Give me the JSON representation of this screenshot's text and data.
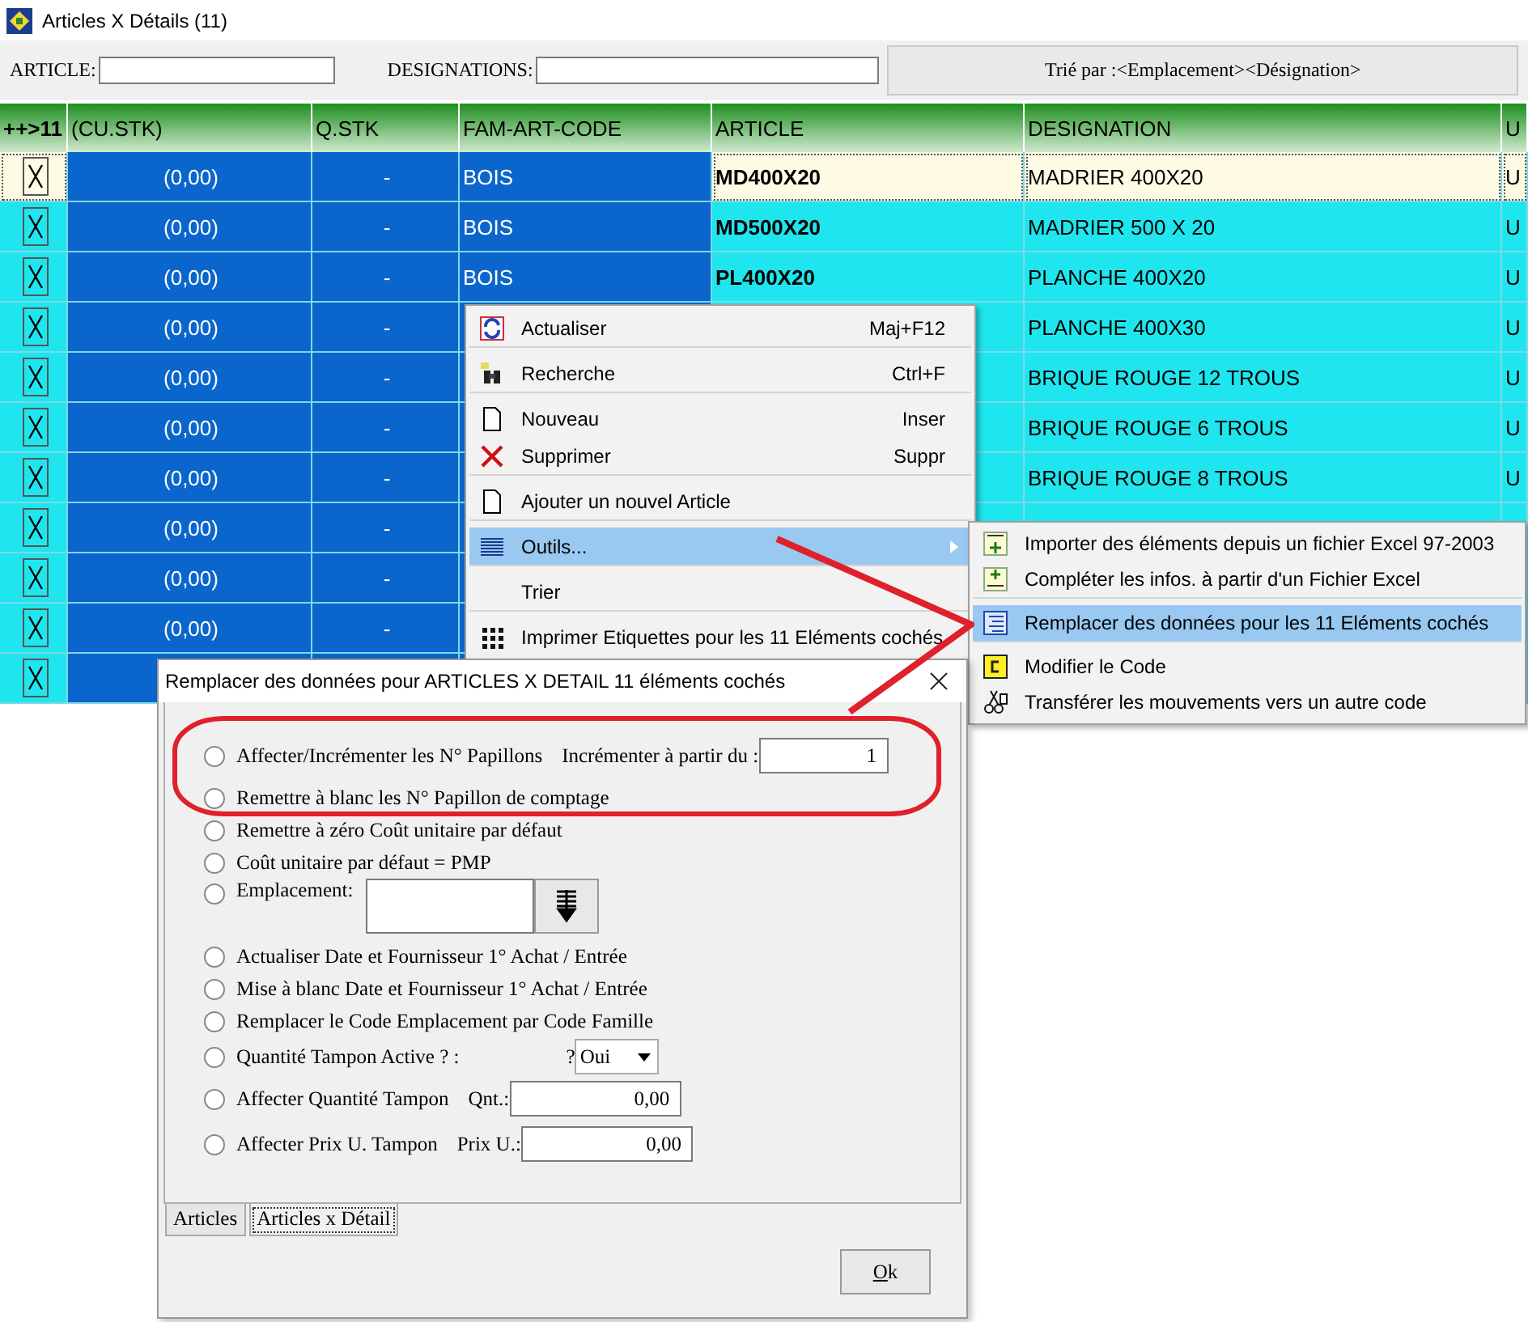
{
  "window": {
    "title": "Articles X Détails (11)"
  },
  "toolbar": {
    "article_label": "ARTICLE:",
    "designations_label": "DESIGNATIONS:",
    "sort_button": "Trié par :<Emplacement><Désignation>"
  },
  "table": {
    "columns": [
      "++>11",
      "(CU.STK)",
      "Q.STK",
      "FAM-ART-CODE",
      "ARTICLE",
      "DESIGNATION",
      "U"
    ],
    "rows": [
      {
        "selected": true,
        "checked": true,
        "cu_stk": "(0,00)",
        "q_stk": "-",
        "family": "BOIS",
        "article": "MD400X20",
        "designation": "MADRIER 400X20",
        "unit": "U"
      },
      {
        "selected": false,
        "checked": true,
        "cu_stk": "(0,00)",
        "q_stk": "-",
        "family": "BOIS",
        "article": "MD500X20",
        "designation": "MADRIER 500 X 20",
        "unit": "U"
      },
      {
        "selected": false,
        "checked": true,
        "cu_stk": "(0,00)",
        "q_stk": "-",
        "family": "BOIS",
        "article": "PL400X20",
        "designation": "PLANCHE 400X20",
        "unit": "U"
      },
      {
        "selected": false,
        "checked": true,
        "cu_stk": "(0,00)",
        "q_stk": "-",
        "designation": "PLANCHE 400X30",
        "unit": "U"
      },
      {
        "selected": false,
        "checked": true,
        "cu_stk": "(0,00)",
        "q_stk": "-",
        "designation": "BRIQUE ROUGE 12 TROUS",
        "unit": "U"
      },
      {
        "selected": false,
        "checked": true,
        "cu_stk": "(0,00)",
        "q_stk": "-",
        "designation": "BRIQUE ROUGE 6 TROUS",
        "unit": "U"
      },
      {
        "selected": false,
        "checked": true,
        "cu_stk": "(0,00)",
        "q_stk": "-",
        "designation": "BRIQUE ROUGE 8 TROUS",
        "unit": "U"
      },
      {
        "selected": false,
        "checked": true,
        "cu_stk": "(0,00)",
        "q_stk": "-"
      },
      {
        "selected": false,
        "checked": true,
        "cu_stk": "(0,00)",
        "q_stk": "-"
      },
      {
        "selected": false,
        "checked": true,
        "cu_stk": "(0,00)",
        "q_stk": "-"
      },
      {
        "selected": false,
        "checked": true
      }
    ]
  },
  "context_menu": {
    "items": [
      {
        "label": "Actualiser",
        "shortcut": "Maj+F12",
        "selected": false,
        "has_submenu": false,
        "separator_after": true
      },
      {
        "label": "Recherche",
        "shortcut": "Ctrl+F",
        "selected": false,
        "has_submenu": false,
        "separator_after": true
      },
      {
        "label": "Nouveau",
        "shortcut": "Inser",
        "selected": false,
        "has_submenu": false,
        "separator_after": false
      },
      {
        "label": "Supprimer",
        "shortcut": "Suppr",
        "selected": false,
        "has_submenu": false,
        "separator_after": true
      },
      {
        "label": "Ajouter un nouvel Article",
        "selected": false,
        "has_submenu": false,
        "separator_after": true
      },
      {
        "label": "Outils...",
        "selected": true,
        "has_submenu": true,
        "separator_after": true
      },
      {
        "label": "Trier",
        "selected": false,
        "has_submenu": false,
        "separator_after": true
      },
      {
        "label": "Imprimer Etiquettes pour les 11 Eléments cochés",
        "selected": false,
        "has_submenu": false,
        "separator_after": false
      }
    ]
  },
  "submenu": {
    "items": [
      {
        "label": "Importer des éléments depuis un fichier Excel 97-2003",
        "selected": false,
        "separator_after": false
      },
      {
        "label": "Compléter les infos. à partir d'un Fichier Excel",
        "selected": false,
        "separator_after": true
      },
      {
        "label": "Remplacer des données pour les 11 Eléments cochés",
        "selected": true,
        "separator_after": true
      },
      {
        "label": "Modifier le Code",
        "selected": false,
        "separator_after": false
      },
      {
        "label": "Transférer les mouvements vers un autre code",
        "selected": false,
        "separator_after": false
      }
    ]
  },
  "dialog": {
    "title": "Remplacer des données pour ARTICLES X DETAIL 11 éléments cochés",
    "options": [
      {
        "kind": "counter",
        "label": "Affecter/Incrémenter les N° Papillons",
        "field_label": "Incrémenter à partir du :",
        "value": "1",
        "selected": false
      },
      {
        "kind": "plain",
        "label": "Remettre à blanc les N° Papillon de comptage",
        "selected": false
      },
      {
        "kind": "plain",
        "label": "Remettre à zéro Coût unitaire par défaut",
        "selected": false
      },
      {
        "kind": "plain",
        "label": "Coût unitaire par défaut =  PMP",
        "selected": false
      },
      {
        "kind": "location",
        "label": "Emplacement:",
        "selected": false
      },
      {
        "kind": "plain",
        "label": "Actualiser Date et Fournisseur 1° Achat / Entrée",
        "selected": false
      },
      {
        "kind": "plain",
        "label": "Mise à blanc Date et Fournisseur 1° Achat / Entrée",
        "selected": false
      },
      {
        "kind": "plain",
        "label": "Remplacer le Code Emplacement par Code Famille",
        "selected": false
      },
      {
        "kind": "choice",
        "label": "Quantité Tampon Active ? :",
        "field_label": "?",
        "value": "Oui",
        "selected": false
      },
      {
        "kind": "amount",
        "label": "Affecter Quantité Tampon",
        "field_label": "Qnt.:",
        "value": "0,00",
        "selected": false
      },
      {
        "kind": "amount",
        "label": "Affecter Prix U. Tampon",
        "field_label": "Prix U.:",
        "value": "0,00",
        "selected": false
      }
    ],
    "tabs": [
      {
        "label": "Articles",
        "selected": false
      },
      {
        "label": "Articles x Détail",
        "selected": true
      }
    ],
    "ok_button": "Ok"
  }
}
